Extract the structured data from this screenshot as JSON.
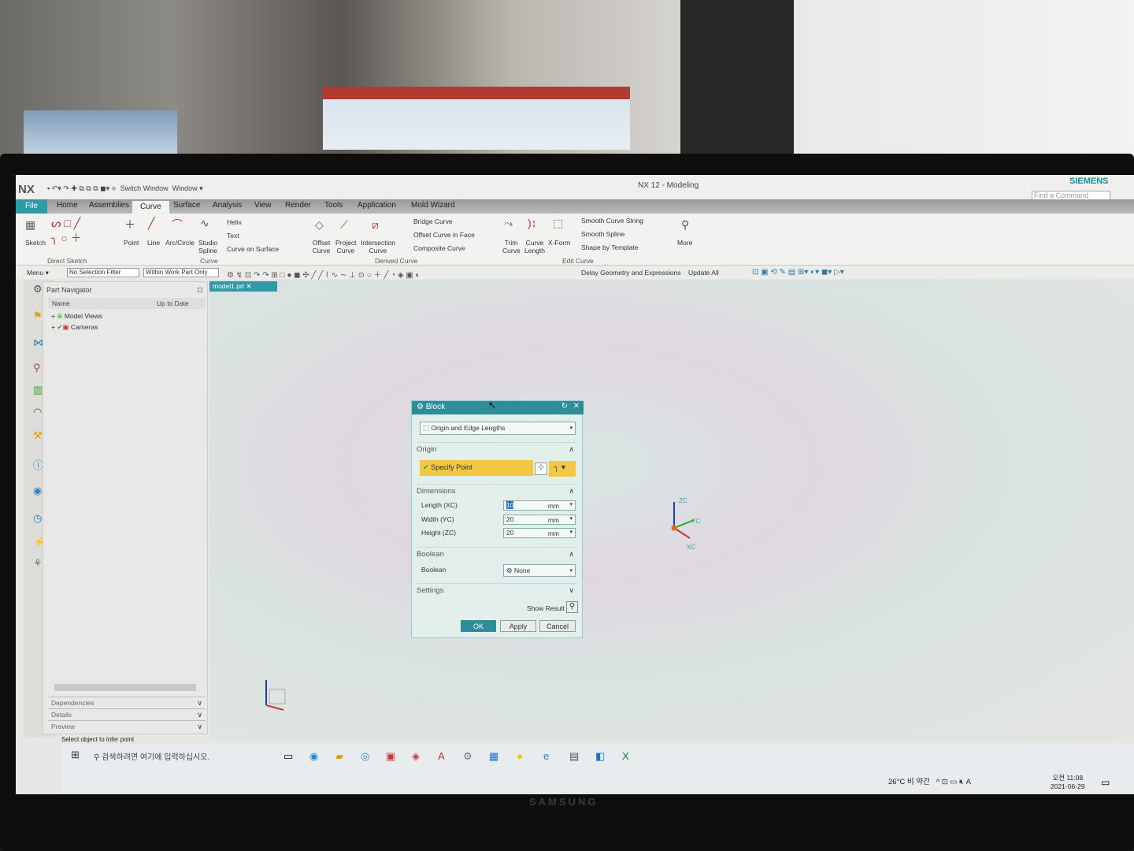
{
  "app": {
    "logo": "NX",
    "title": "NX 12 - Modeling",
    "brand": "SIEMENS",
    "find_placeholder": "Find a Command",
    "quick_access": [
      "Switch Window",
      "Window ▾"
    ]
  },
  "tabs": [
    "File",
    "Home",
    "Assemblies",
    "Curve",
    "Surface",
    "Analysis",
    "View",
    "Render",
    "Tools",
    "Application",
    "Mold Wizard"
  ],
  "active_tab": "Curve",
  "ribbon": {
    "direct_sketch": {
      "sketch": "Sketch",
      "group": "Direct Sketch"
    },
    "curve": {
      "point": "Point",
      "line": "Line",
      "arc": "Arc/Circle",
      "studio": "Studio Spline",
      "list": [
        "Helix",
        "Text",
        "Curve on Surface"
      ],
      "group": "Curve"
    },
    "derived": {
      "offset": "Offset Curve",
      "project": "Project Curve",
      "intersection": "Intersection Curve",
      "list": [
        "Bridge Curve",
        "Offset Curve in Face",
        "Composite Curve"
      ],
      "group": "Derived Curve"
    },
    "edit": {
      "trim": "Trim Curve",
      "length": "Curve Length",
      "xform": "X-Form",
      "list": [
        "Smooth Curve String",
        "Smooth Spline",
        "Shape by Template"
      ],
      "group": "Edit Curve"
    },
    "more": "More"
  },
  "selection_bar": {
    "menu": "Menu ▾",
    "filter": "No Selection Filter",
    "scope": "Within Work Part Only",
    "delay": "Delay Geometry and Expressions",
    "update": "Update All"
  },
  "navigator": {
    "title": "Part Navigator",
    "col_name": "Name",
    "col_uptodate": "Up to Date",
    "rows": [
      "Model Views",
      "Cameras"
    ],
    "sections": [
      "Dependencies",
      "Details",
      "Preview"
    ]
  },
  "document_tab": "model1.prt",
  "triad": {
    "z": "ZC",
    "y": "YC",
    "x": "XC"
  },
  "dialog": {
    "title": "Block",
    "type": "Origin and Edge Lengths",
    "origin": {
      "label": "Origin",
      "specify": "Specify Point"
    },
    "dimensions": {
      "label": "Dimensions",
      "rows": [
        {
          "label": "Length (XC)",
          "value": "10",
          "unit": "mm"
        },
        {
          "label": "Width (YC)",
          "value": "20",
          "unit": "mm"
        },
        {
          "label": "Height (ZC)",
          "value": "20",
          "unit": "mm"
        }
      ]
    },
    "boolean": {
      "label": "Boolean",
      "field": "Boolean",
      "value": "None"
    },
    "settings": "Settings",
    "show_result": "Show Result",
    "ok": "OK",
    "apply": "Apply",
    "cancel": "Cancel"
  },
  "status": "Select object to infer point",
  "taskbar": {
    "search_placeholder": "검색하려면 여기에 입력하십시오.",
    "weather": "26°C 비 약간",
    "ime": "A",
    "time_period": "오전 11:08",
    "date": "2021-06-29"
  },
  "monitor_brand": "SAMSUNG",
  "colors": {
    "accent": "#2f9aa6",
    "specify_point": "#f2c744",
    "dialog_header": "#2f8d99"
  }
}
